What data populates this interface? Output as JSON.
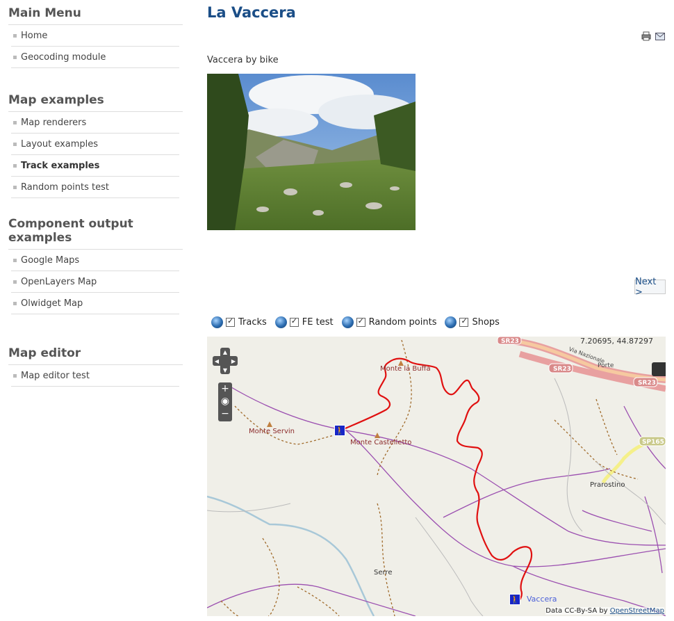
{
  "sidebar": {
    "main_menu": {
      "title": "Main Menu",
      "items": [
        "Home",
        "Geocoding module"
      ]
    },
    "map_examples": {
      "title": "Map examples",
      "items": [
        "Map renderers",
        "Layout examples",
        "Track examples",
        "Random points test"
      ],
      "active": "Track examples"
    },
    "component_output": {
      "title": "Component output examples",
      "items": [
        "Google Maps",
        "OpenLayers Map",
        "Olwidget Map"
      ]
    },
    "map_editor": {
      "title": "Map editor",
      "items": [
        "Map editor test"
      ]
    }
  },
  "main": {
    "title": "La Vaccera",
    "intro": "Vaccera by bike",
    "next_label": "Next >",
    "layers": [
      {
        "name": "Tracks",
        "checked": true
      },
      {
        "name": "FE test",
        "checked": true
      },
      {
        "name": "Random points",
        "checked": true
      },
      {
        "name": "Shops",
        "checked": true
      }
    ],
    "map": {
      "coords": "7.20695, 44.87297",
      "attribution_prefix": "Data CC-By-SA by",
      "attribution_link": "OpenStreetMap",
      "labels": {
        "monte_la_buffa": "Monte la Buffa",
        "monte_servin": "Monte Servin",
        "monte_castelletto": "Monte Castelletto",
        "prarostino": "Prarostino",
        "serre": "Serre",
        "vaccera": "Vaccera",
        "via_nazionale": "Via Nazionale",
        "porte": "Porte"
      },
      "road_shields": [
        "SR23",
        "SR23",
        "SR23",
        "SP165"
      ],
      "track_color": "#e01010"
    }
  }
}
